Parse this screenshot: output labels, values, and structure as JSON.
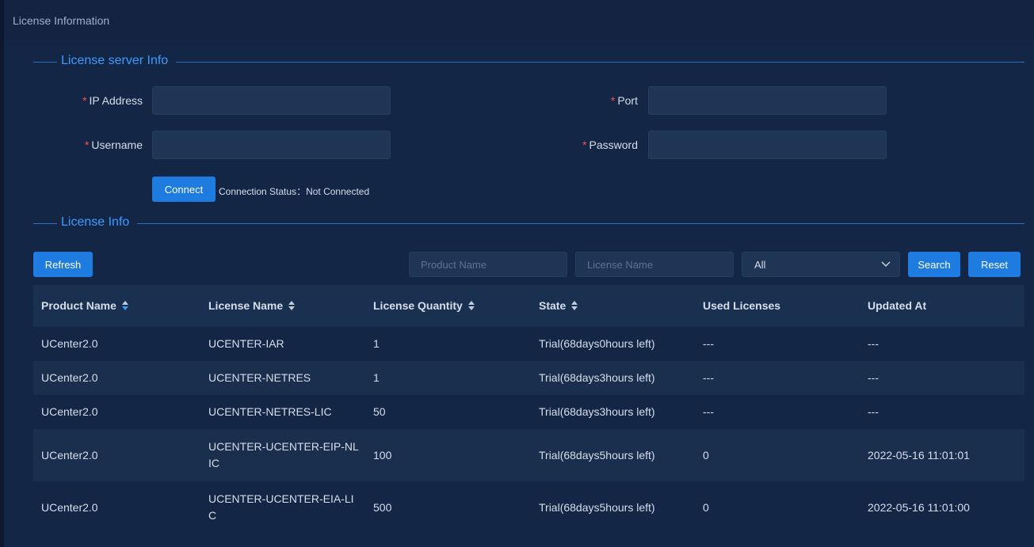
{
  "page": {
    "title": "License Information"
  },
  "server_section": {
    "title": "License server Info"
  },
  "form": {
    "required_mark": "*",
    "ip_label": "IP Address",
    "port_label": "Port",
    "username_label": "Username",
    "password_label": "Password",
    "ip_value": "",
    "port_value": "",
    "username_value": "",
    "password_value": "",
    "connect_label": "Connect",
    "status_label": "Connection Status：",
    "status_value": "Not Connected"
  },
  "license_section": {
    "title": "License Info"
  },
  "toolbar": {
    "refresh_label": "Refresh",
    "product_placeholder": "Product Name",
    "license_placeholder": "License Name",
    "state_select_value": "All",
    "search_label": "Search",
    "reset_label": "Reset"
  },
  "colors": {
    "accent": "#1e7ce0",
    "section_title": "#3d9bff",
    "required": "#ff4d4f",
    "background": "#132646"
  },
  "table": {
    "columns": [
      {
        "label": "Product Name",
        "sortable": true,
        "sort": "desc"
      },
      {
        "label": "License Name",
        "sortable": true,
        "sort": "none"
      },
      {
        "label": "License Quantity",
        "sortable": true,
        "sort": "none"
      },
      {
        "label": "State",
        "sortable": true,
        "sort": "none"
      },
      {
        "label": "Used Licenses",
        "sortable": false
      },
      {
        "label": "Updated At",
        "sortable": false
      }
    ],
    "rows": [
      {
        "product": "UCenter2.0",
        "license": "UCENTER-IAR",
        "quantity": "1",
        "state": "Trial(68days0hours left)",
        "used": "---",
        "updated": "---"
      },
      {
        "product": "UCenter2.0",
        "license": "UCENTER-NETRES",
        "quantity": "1",
        "state": "Trial(68days3hours left)",
        "used": "---",
        "updated": "---"
      },
      {
        "product": "UCenter2.0",
        "license": "UCENTER-NETRES-LIC",
        "quantity": "50",
        "state": "Trial(68days3hours left)",
        "used": "---",
        "updated": "---"
      },
      {
        "product": "UCenter2.0",
        "license": "UCENTER-UCENTER-EIP-NLIC",
        "quantity": "100",
        "state": "Trial(68days5hours left)",
        "used": "0",
        "updated": "2022-05-16 11:01:01"
      },
      {
        "product": "UCenter2.0",
        "license": "UCENTER-UCENTER-EIA-LIC",
        "quantity": "500",
        "state": "Trial(68days5hours left)",
        "used": "0",
        "updated": "2022-05-16 11:01:00"
      }
    ]
  }
}
